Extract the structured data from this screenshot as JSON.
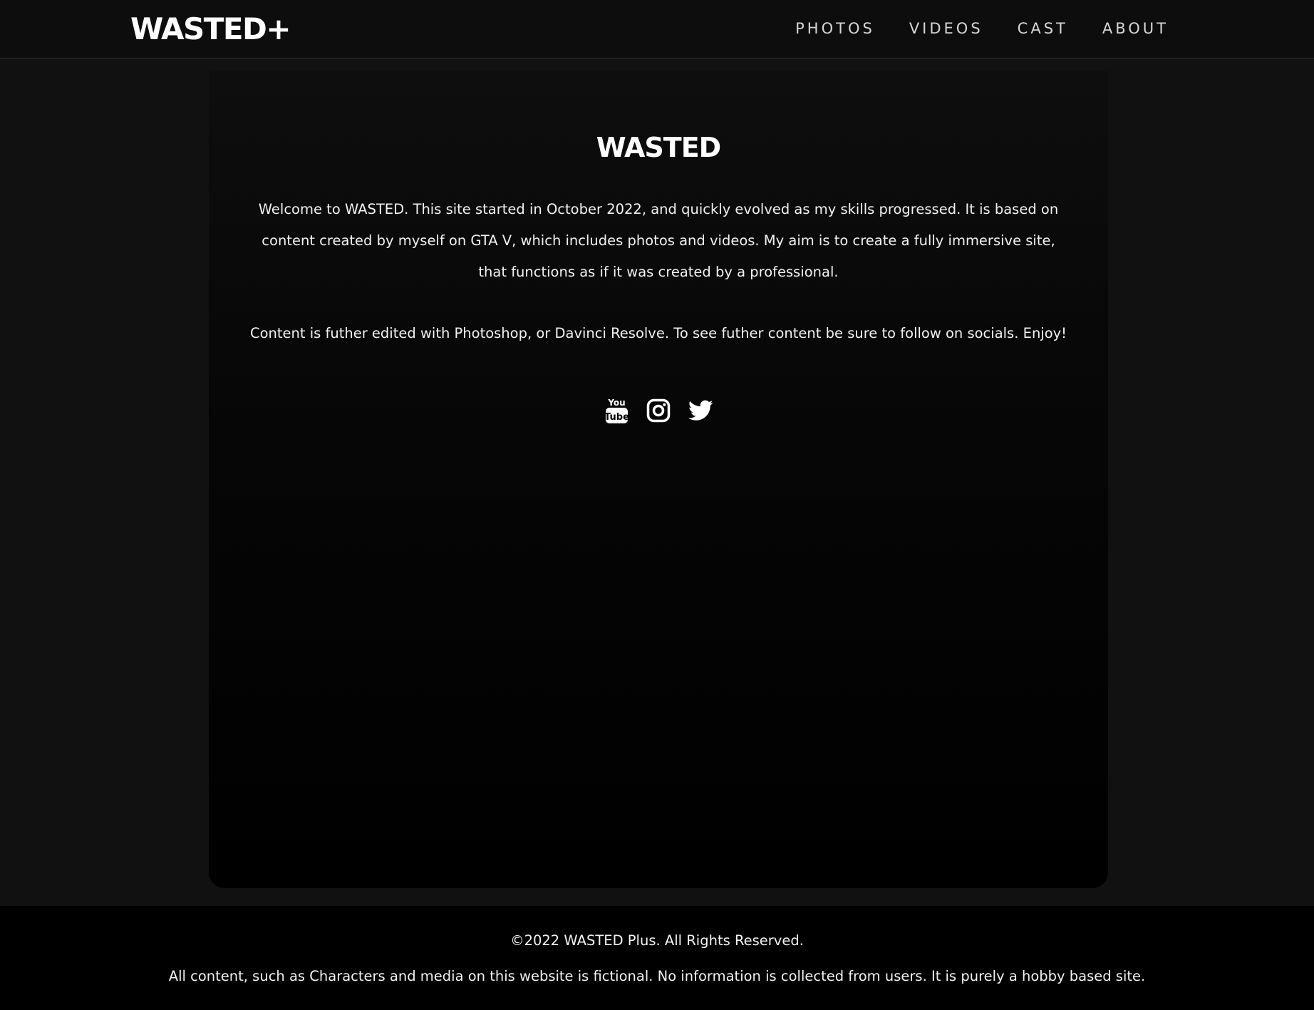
{
  "header": {
    "logo": "WASTED+",
    "nav": [
      "PHOTOS",
      "VIDEOS",
      "CAST",
      "ABOUT"
    ]
  },
  "main": {
    "title": "WASTED",
    "paragraph1": "Welcome to WASTED. This site started in October 2022, and quickly evolved as my skills progressed. It is based on content created by myself on GTA V, which includes photos and videos. My aim is to create a fully immersive site, that functions as if it was created by a professional.",
    "paragraph2": "Content is futher edited with Photoshop, or Davinci Resolve. To see futher content be sure to follow on socials. Enjoy!",
    "socials": [
      {
        "icon": "youtube-icon",
        "label_top": "You",
        "label_bottom": "Tube"
      },
      {
        "icon": "instagram-icon"
      },
      {
        "icon": "twitter-icon"
      }
    ]
  },
  "footer": {
    "copyright": "©2022 WASTED Plus. All Rights Reserved.",
    "disclaimer": "All content, such as Characters and media on this website is fictional. No information is collected from users. It is purely a hobby based site."
  },
  "colors": {
    "page_bg": "#111111",
    "header_bg": "#0d0d0d",
    "footer_bg": "#000000",
    "text": "#ffffff",
    "nav_text": "#d6d6d6"
  }
}
